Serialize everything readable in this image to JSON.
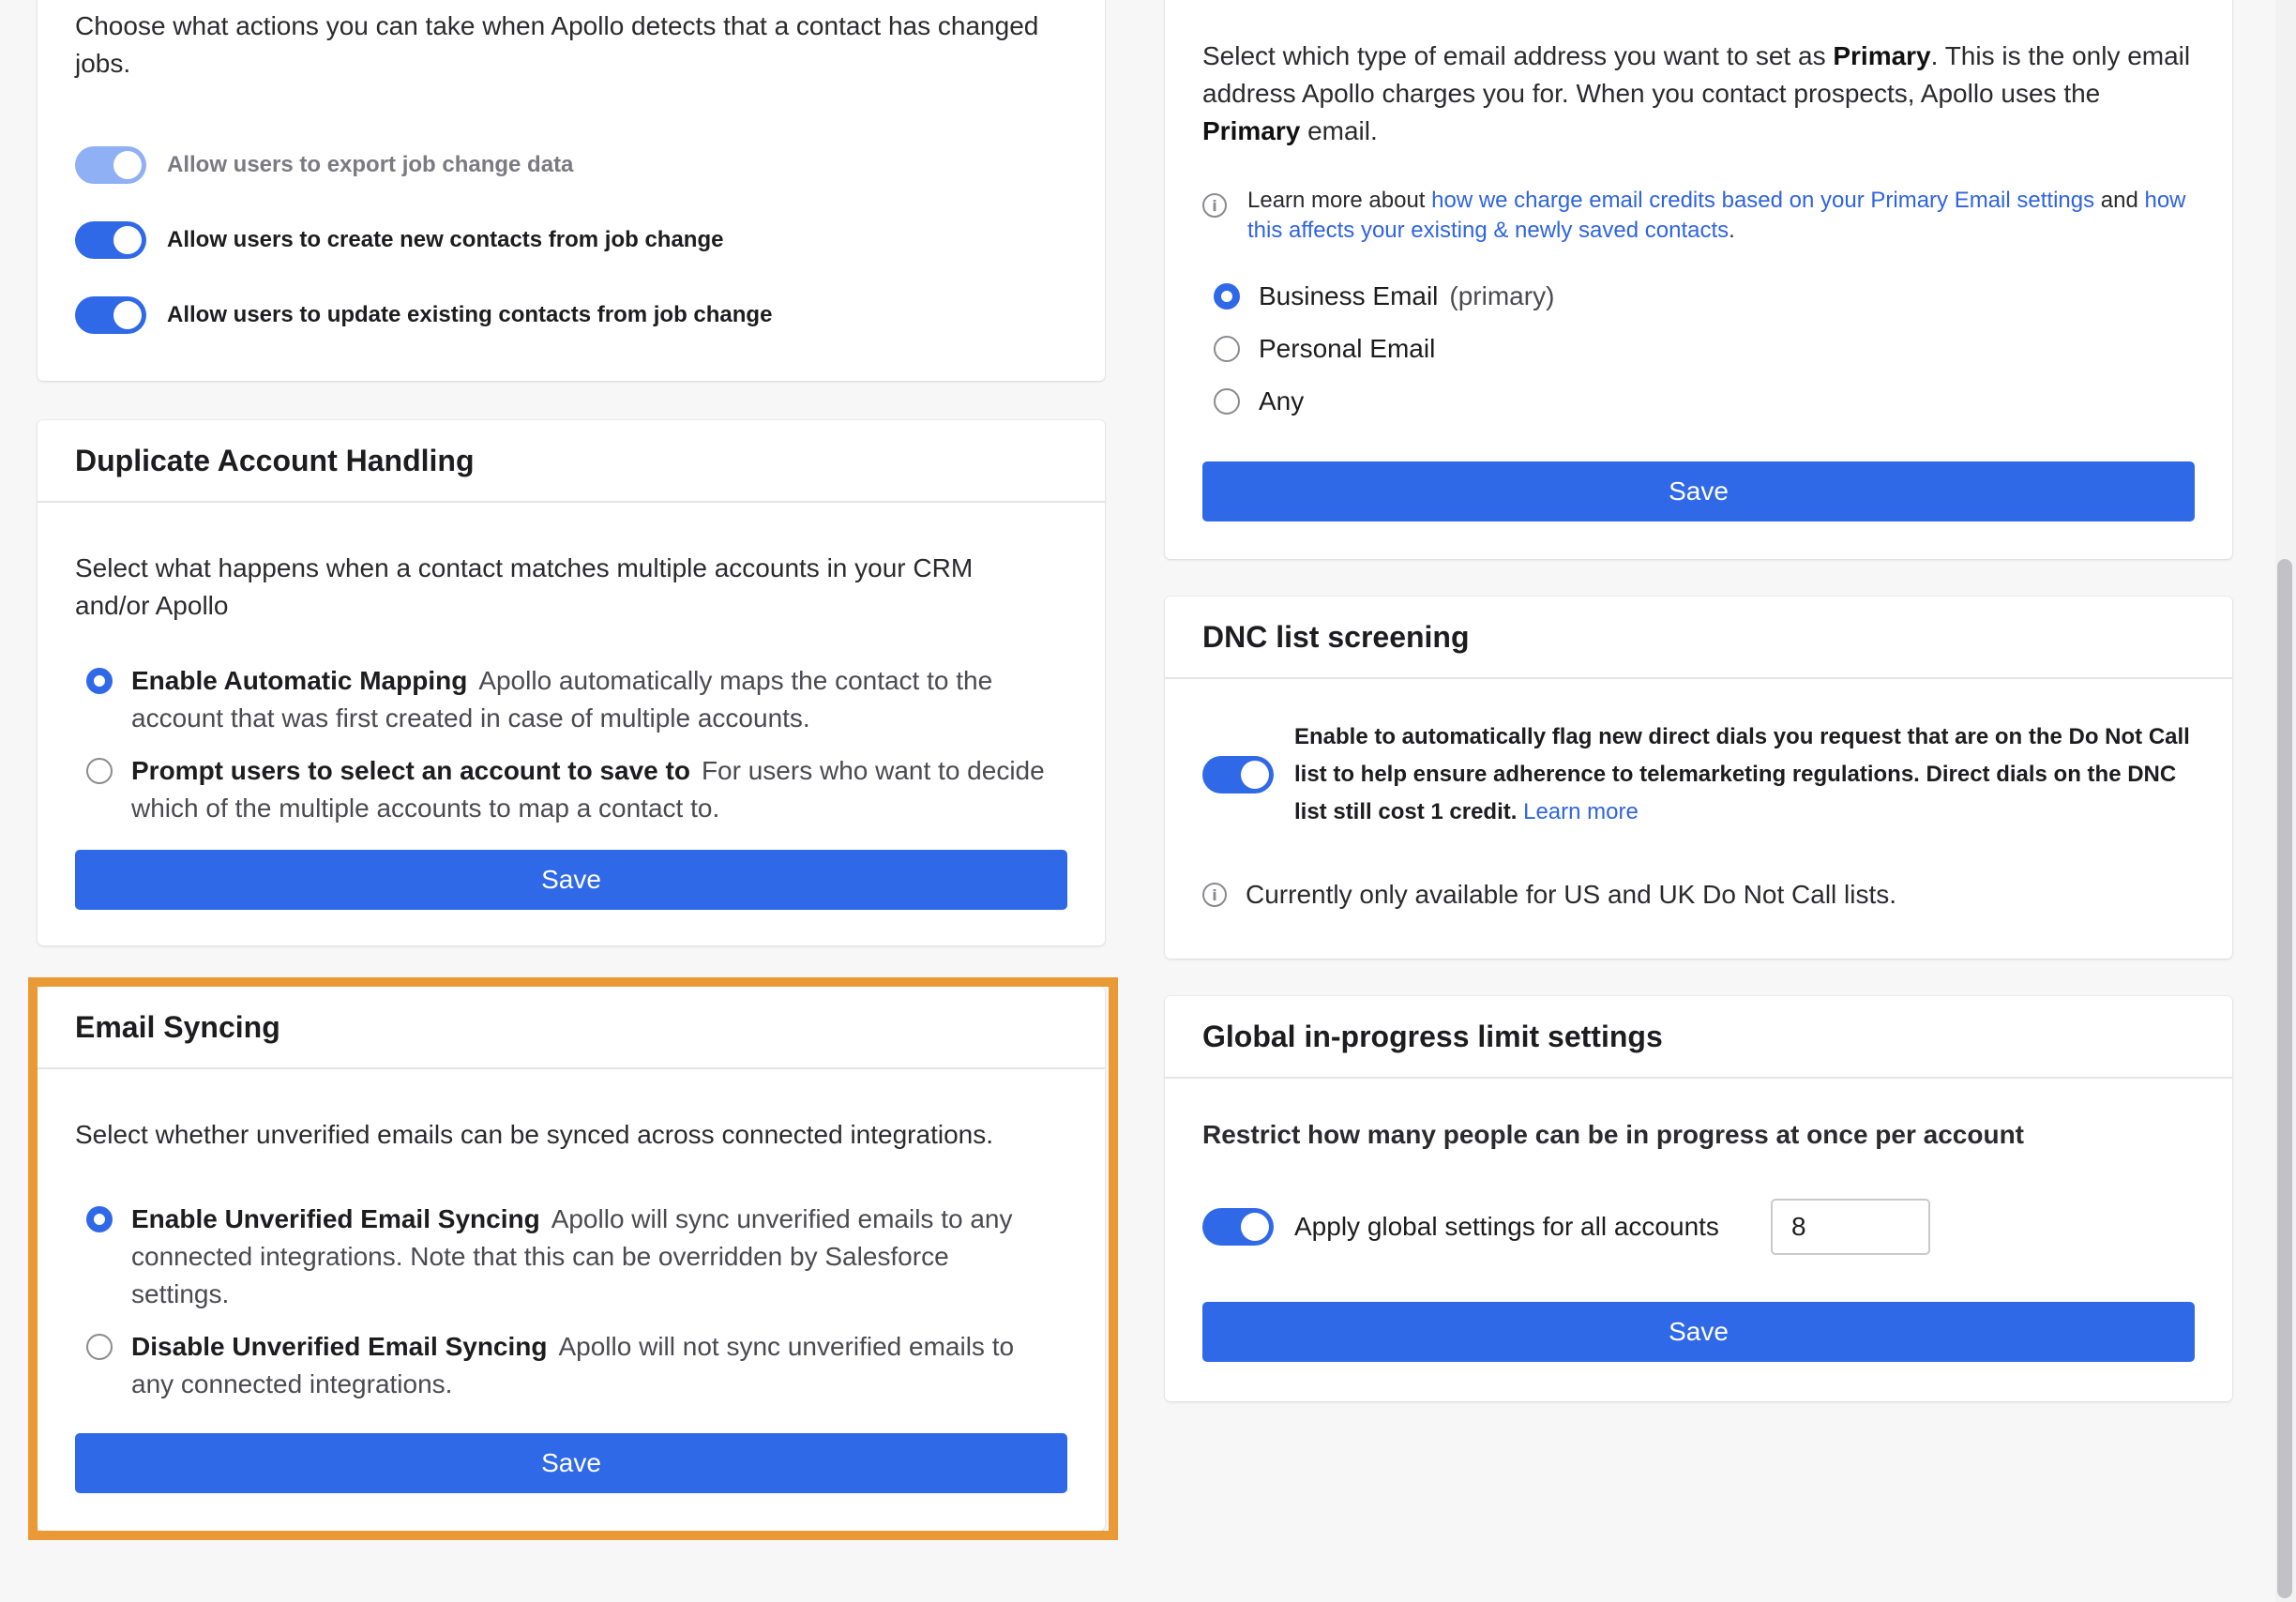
{
  "job_change": {
    "description": "Choose what actions you can take when Apollo detects that a contact has changed jobs.",
    "toggles": [
      {
        "label": "Allow users to export job change data",
        "enabled": true,
        "disabled": true
      },
      {
        "label": "Allow users to create new contacts from job change",
        "enabled": true,
        "disabled": false
      },
      {
        "label": "Allow users to update existing contacts from job change",
        "enabled": true,
        "disabled": false
      }
    ]
  },
  "duplicate_account": {
    "title": "Duplicate Account Handling",
    "description": "Select what happens when a contact matches multiple accounts in your CRM and/or Apollo",
    "options": [
      {
        "label": "Enable Automatic Mapping",
        "detail": "Apollo automatically maps the contact to the account that was first created in case of multiple accounts.",
        "checked": true
      },
      {
        "label": "Prompt users to select an account to save to",
        "detail": "For users who want to decide which of the multiple accounts to map a contact to.",
        "checked": false
      }
    ],
    "save_label": "Save"
  },
  "email_syncing": {
    "title": "Email Syncing",
    "description": "Select whether unverified emails can be synced across connected integrations.",
    "options": [
      {
        "label": "Enable Unverified Email Syncing",
        "detail": "Apollo will sync unverified emails to any connected integrations. Note that this can be overridden by Salesforce settings.",
        "checked": true
      },
      {
        "label": "Disable Unverified Email Syncing",
        "detail": "Apollo will not sync unverified emails to any connected integrations.",
        "checked": false
      }
    ],
    "save_label": "Save",
    "highlight_color": "#ea9a35"
  },
  "primary_email": {
    "desc_part1": "Select which type of email address you want to set as ",
    "desc_bold1": "Primary",
    "desc_part2": ". This is the only email address Apollo charges you for. When you contact prospects, Apollo uses the ",
    "desc_bold2": "Primary",
    "desc_part3": " email.",
    "info_prefix": "Learn more about ",
    "info_link1": "how we charge email credits based on your Primary Email settings",
    "info_mid": " and ",
    "info_link2": "how this affects your existing & newly saved contacts",
    "info_suffix": ".",
    "options": [
      {
        "label": "Business Email",
        "detail": "(primary)",
        "checked": true
      },
      {
        "label": "Personal Email",
        "detail": "",
        "checked": false
      },
      {
        "label": "Any",
        "detail": "",
        "checked": false
      }
    ],
    "save_label": "Save"
  },
  "dnc": {
    "title": "DNC list screening",
    "toggle_text": "Enable to automatically flag new direct dials you request that are on the Do Not Call list to help ensure adherence to telemarketing regulations. Direct dials on the DNC list still cost 1 credit.",
    "learn_more": "Learn more",
    "note": "Currently only available for US and UK Do Not Call lists.",
    "enabled": true
  },
  "global_limit": {
    "title": "Global in-progress limit settings",
    "description": "Restrict how many people can be in progress at once per account",
    "toggle_label": "Apply global settings for all accounts",
    "limit_value": "8",
    "save_label": "Save",
    "enabled": true
  },
  "colors": {
    "accent": "#3069e8",
    "link": "#2f64e0"
  }
}
